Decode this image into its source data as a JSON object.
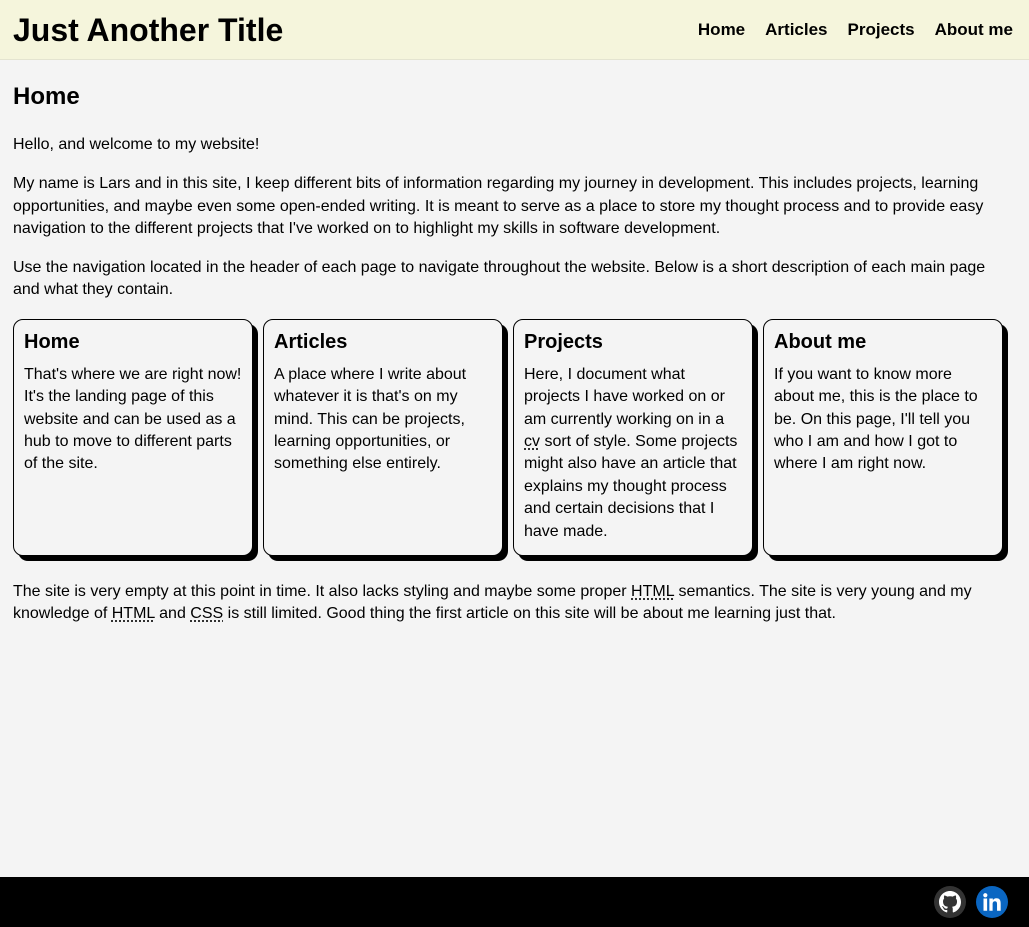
{
  "header": {
    "title": "Just Another Title",
    "nav": [
      "Home",
      "Articles",
      "Projects",
      "About me"
    ]
  },
  "main": {
    "title": "Home",
    "intro": [
      "Hello, and welcome to my website!",
      "My name is Lars and in this site, I keep different bits of information regarding my journey in development. This includes projects, learning opportunities, and maybe even some open-ended writing. It is meant to serve as a place to store my thought process and to provide easy navigation to the different projects that I've worked on to highlight my skills in software development.",
      "Use the navigation located in the header of each page to navigate throughout the website. Below is a short description of each main page and what they contain."
    ],
    "cards": [
      {
        "title": "Home",
        "text": "That's where we are right now! It's the landing page of this website and can be used as a hub to move to different parts of the site."
      },
      {
        "title": "Articles",
        "text": "A place where I write about whatever it is that's on my mind. This can be projects, learning opportunities, or something else entirely."
      },
      {
        "title": "Projects",
        "text_before": "Here, I document what projects I have worked on or am currently working on in a ",
        "abbr": "cv",
        "text_after": " sort of style. Some projects might also have an article that explains my thought process and certain decisions that I have made."
      },
      {
        "title": "About me",
        "text": "If you want to know more about me, this is the place to be. On this page, I'll tell you who I am and how I got to where I am right now."
      }
    ],
    "closing": {
      "part1": "The site is very empty at this point in time. It also lacks styling and maybe some proper ",
      "abbr1": "HTML",
      "part2": " semantics. The site is very young and my knowledge of ",
      "abbr2": "HTML",
      "part3": " and ",
      "abbr3": "CSS",
      "part4": " is still limited. Good thing the first article on this site will be about me learning just that."
    }
  },
  "footer": {
    "icons": [
      "github-icon",
      "linkedin-icon"
    ],
    "colors": {
      "github": "#333333",
      "linkedin": "#0a66c2"
    }
  }
}
